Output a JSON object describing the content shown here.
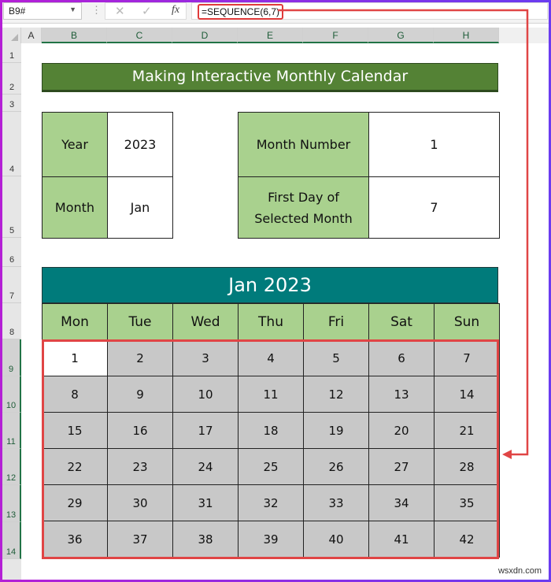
{
  "formula_bar": {
    "name_box": "B9#",
    "cancel_icon": "✕",
    "enter_icon": "✓",
    "fx_label": "fx",
    "formula": "=SEQUENCE(6,7)"
  },
  "columns": [
    "A",
    "B",
    "C",
    "D",
    "E",
    "F",
    "G",
    "H"
  ],
  "rows": [
    "1",
    "2",
    "3",
    "4",
    "5",
    "6",
    "7",
    "8",
    "9",
    "10",
    "11",
    "12",
    "13",
    "14"
  ],
  "sheet": {
    "title": "Making Interactive Monthly Calendar",
    "inputs": {
      "year_label": "Year",
      "year_value": "2023",
      "month_label": "Month",
      "month_value": "Jan"
    },
    "info": {
      "month_number_label": "Month Number",
      "month_number_value": "1",
      "first_day_label_line1": "First Day of",
      "first_day_label_line2": "Selected Month",
      "first_day_value": "7"
    },
    "calendar": {
      "title": "Jan 2023",
      "weekdays": [
        "Mon",
        "Tue",
        "Wed",
        "Thu",
        "Fri",
        "Sat",
        "Sun"
      ],
      "weeks": [
        [
          "1",
          "2",
          "3",
          "4",
          "5",
          "6",
          "7"
        ],
        [
          "8",
          "9",
          "10",
          "11",
          "12",
          "13",
          "14"
        ],
        [
          "15",
          "16",
          "17",
          "18",
          "19",
          "20",
          "21"
        ],
        [
          "22",
          "23",
          "24",
          "25",
          "26",
          "27",
          "28"
        ],
        [
          "29",
          "30",
          "31",
          "32",
          "33",
          "34",
          "35"
        ],
        [
          "36",
          "37",
          "38",
          "39",
          "40",
          "41",
          "42"
        ]
      ]
    }
  },
  "colors": {
    "title_green": "#548235",
    "label_green": "#a9d18e",
    "calendar_teal": "#007b7b",
    "day_cell_gray": "#c8c8c8",
    "highlight_red": "#e04545",
    "excel_green": "#217346"
  },
  "watermark": "wsxdn.com"
}
